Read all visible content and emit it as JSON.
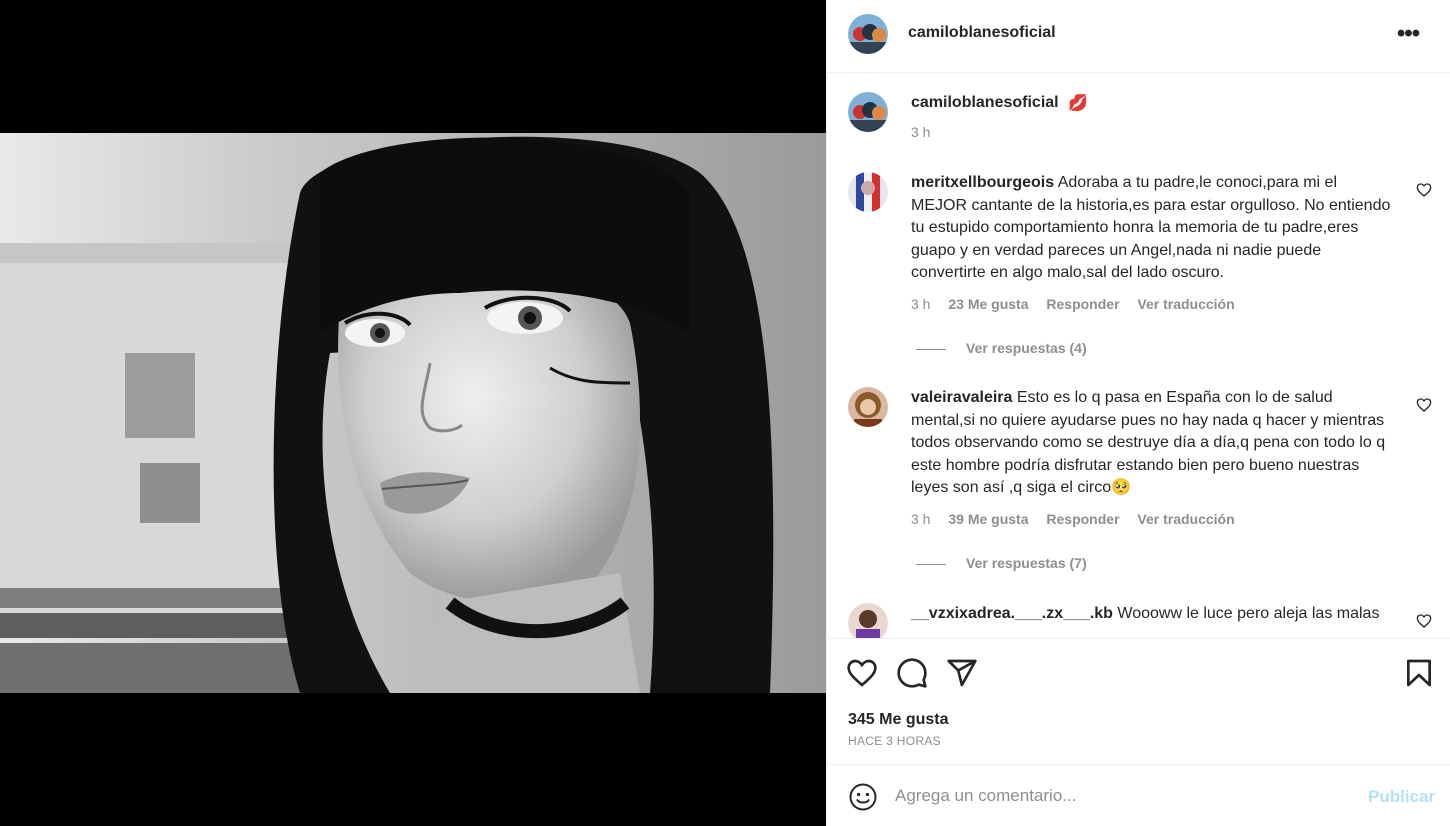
{
  "post": {
    "username": "camiloblanesoficial",
    "caption_username": "camiloblanesoficial",
    "caption_emoji": "💋",
    "caption_time": "3 h",
    "likes": "345 Me gusta",
    "posted": "HACE 3 HORAS"
  },
  "comments": [
    {
      "username": "meritxellbourgeois",
      "text": "Adoraba a tu padre,le conoci,para mi el MEJOR cantante de la historia,es para estar orgulloso. No entiendo tu estupido comportamiento honra la memoria de tu padre,eres guapo y en verdad pareces un Angel,nada ni nadie puede convertirte en algo malo,sal del lado oscuro.",
      "time": "3 h",
      "likes": "23 Me gusta",
      "reply": "Responder",
      "translate": "Ver traducción",
      "replies": "Ver respuestas (4)"
    },
    {
      "username": "valeiravaleira",
      "text": "Esto es lo q pasa en España con lo de salud mental,si no quiere ayudarse pues no hay nada q hacer y mientras todos observando como se destruye día a día,q pena con todo lo q este hombre podría disfrutar estando bien pero bueno nuestras leyes son así ,q siga el circo🥺",
      "time": "3 h",
      "likes": "39 Me gusta",
      "reply": "Responder",
      "translate": "Ver traducción",
      "replies": "Ver respuestas (7)"
    },
    {
      "username": "__vzxixadrea.___.zx___.kb",
      "text": "Woooww le luce pero aleja las malas"
    }
  ],
  "composer": {
    "placeholder": "Agrega un comentario...",
    "publish": "Publicar"
  },
  "icons": {
    "more": "more-options-icon",
    "like": "heart-icon",
    "comment": "comment-icon",
    "share": "send-icon",
    "save": "bookmark-icon",
    "emoji": "emoji-icon"
  },
  "colors": {
    "publish_disabled": "#b2dffc",
    "secondary_text": "#8e8e8e",
    "divider": "#efefef"
  }
}
